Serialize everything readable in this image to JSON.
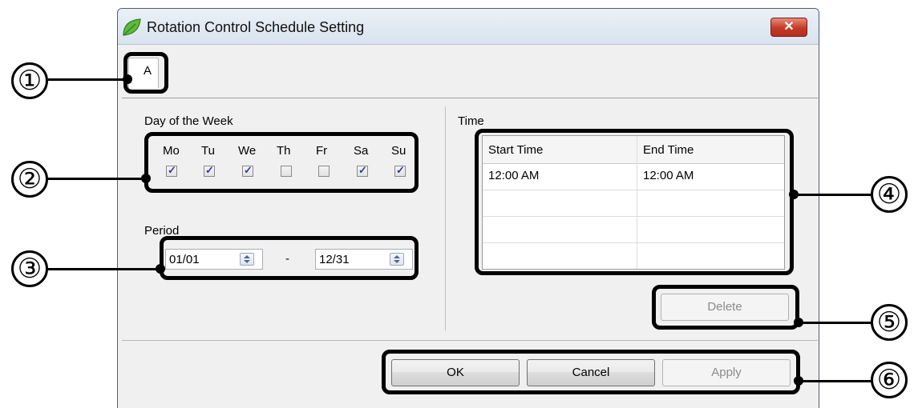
{
  "window": {
    "title": "Rotation Control Schedule Setting",
    "close_label": "✕"
  },
  "tab": {
    "label": "A"
  },
  "day_of_week": {
    "label": "Day of the Week",
    "days": [
      {
        "label": "Mo",
        "checked": true
      },
      {
        "label": "Tu",
        "checked": true
      },
      {
        "label": "We",
        "checked": true
      },
      {
        "label": "Th",
        "checked": false
      },
      {
        "label": "Fr",
        "checked": false
      },
      {
        "label": "Sa",
        "checked": true
      },
      {
        "label": "Su",
        "checked": true
      }
    ]
  },
  "period": {
    "label": "Period",
    "start": "01/01",
    "separator": "-",
    "end": "12/31"
  },
  "time": {
    "label": "Time",
    "columns": [
      "Start Time",
      "End Time"
    ],
    "rows": [
      [
        "12:00 AM",
        "12:00 AM"
      ],
      [
        "",
        ""
      ],
      [
        "",
        ""
      ],
      [
        "",
        ""
      ]
    ]
  },
  "buttons": {
    "delete": "Delete",
    "ok": "OK",
    "cancel": "Cancel",
    "apply": "Apply"
  },
  "callouts": [
    "①",
    "②",
    "③",
    "④",
    "⑤",
    "⑥"
  ],
  "colors": {
    "title_gradient_top": "#eaf0f7",
    "close_red": "#c23b26",
    "checkmark": "#2b3e9c",
    "dialog_bg": "#f0f0f0"
  }
}
